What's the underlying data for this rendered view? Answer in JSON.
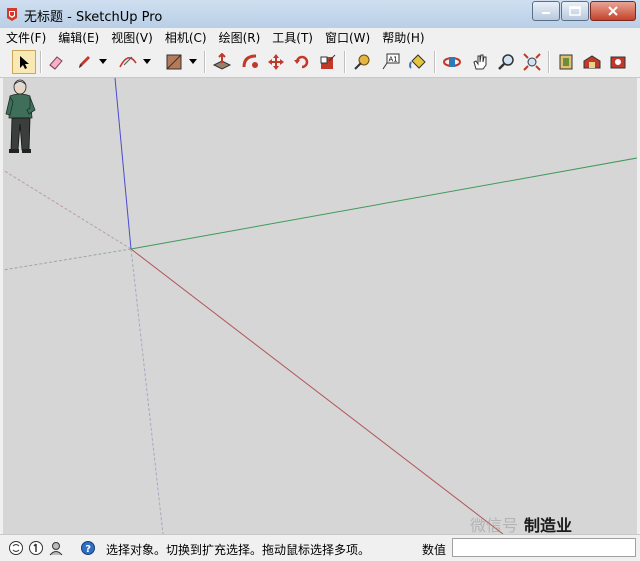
{
  "window": {
    "title": "无标题 - SketchUp Pro"
  },
  "menu": [
    "文件(F)",
    "编辑(E)",
    "视图(V)",
    "相机(C)",
    "绘图(R)",
    "工具(T)",
    "窗口(W)",
    "帮助(H)"
  ],
  "toolbar": {
    "tools": [
      "select",
      "eraser",
      "pencil",
      "arc",
      "rectangle",
      "push-pull",
      "follow-me",
      "move",
      "rotate",
      "scale",
      "tape-measure",
      "text",
      "paint-bucket",
      "orbit",
      "pan",
      "zoom",
      "zoom-extents",
      "component",
      "warehouse",
      "extension-warehouse"
    ],
    "active_tool": "select"
  },
  "statusbar": {
    "hint": "选择对象。切换到扩充选择。拖动鼠标选择多项。",
    "measurements_label": "数值",
    "measurements_value": ""
  },
  "watermark": {
    "left": "微信号",
    "right": "制造业"
  },
  "colors": {
    "canvas": "#d6d6d6",
    "axis_red": "#b0565a",
    "axis_green": "#3f9a5a",
    "axis_blue": "#4a4ad0"
  }
}
